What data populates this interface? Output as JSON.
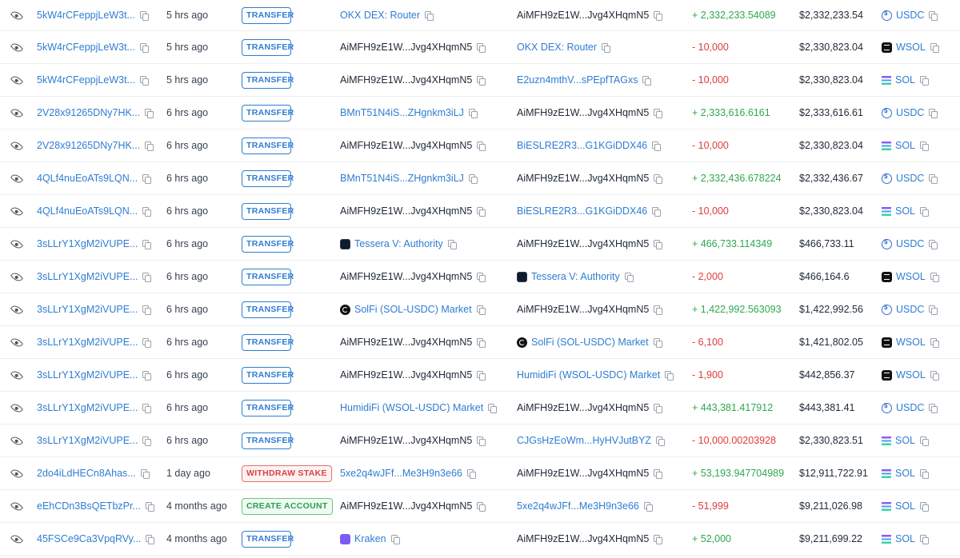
{
  "colors": {
    "link": "#2f7dd1",
    "positive": "#2fa84f",
    "negative": "#e03b3b",
    "transfer_badge": "#2f7dd1",
    "withdraw_badge": "#d64545",
    "create_badge": "#2e9e4f"
  },
  "rows": [
    {
      "sig": "5kW4rCFeppjLeW3t...",
      "time": "5 hrs ago",
      "type": "TRANSFER",
      "type_kind": "transfer",
      "from": "OKX DEX: Router",
      "from_link": true,
      "from_icon": "",
      "to": "AiMFH9zE1W...Jvg4XHqmN5",
      "to_link": false,
      "to_icon": "",
      "amount": "+ 2,332,233.54089",
      "sign": "pos",
      "value": "$2,332,233.54",
      "token": "USDC",
      "token_icon": "usdc-icon"
    },
    {
      "sig": "5kW4rCFeppjLeW3t...",
      "time": "5 hrs ago",
      "type": "TRANSFER",
      "type_kind": "transfer",
      "from": "AiMFH9zE1W...Jvg4XHqmN5",
      "from_link": false,
      "from_icon": "",
      "to": "OKX DEX: Router",
      "to_link": true,
      "to_icon": "",
      "amount": "- 10,000",
      "sign": "neg",
      "value": "$2,330,823.04",
      "token": "WSOL",
      "token_icon": "wsol-icon"
    },
    {
      "sig": "5kW4rCFeppjLeW3t...",
      "time": "5 hrs ago",
      "type": "TRANSFER",
      "type_kind": "transfer",
      "from": "AiMFH9zE1W...Jvg4XHqmN5",
      "from_link": false,
      "from_icon": "",
      "to": "E2uzn4mthV...sPEpfTAGxs",
      "to_link": true,
      "to_icon": "",
      "amount": "- 10,000",
      "sign": "neg",
      "value": "$2,330,823.04",
      "token": "SOL",
      "token_icon": "sol-icon"
    },
    {
      "sig": "2V28x91265DNy7HK...",
      "time": "6 hrs ago",
      "type": "TRANSFER",
      "type_kind": "transfer",
      "from": "BMnT51N4iS...ZHgnkm3iLJ",
      "from_link": true,
      "from_icon": "",
      "to": "AiMFH9zE1W...Jvg4XHqmN5",
      "to_link": false,
      "to_icon": "",
      "amount": "+ 2,333,616.6161",
      "sign": "pos",
      "value": "$2,333,616.61",
      "token": "USDC",
      "token_icon": "usdc-icon"
    },
    {
      "sig": "2V28x91265DNy7HK...",
      "time": "6 hrs ago",
      "type": "TRANSFER",
      "type_kind": "transfer",
      "from": "AiMFH9zE1W...Jvg4XHqmN5",
      "from_link": false,
      "from_icon": "",
      "to": "BiESLRE2R3...G1KGiDDX46",
      "to_link": true,
      "to_icon": "",
      "amount": "- 10,000",
      "sign": "neg",
      "value": "$2,330,823.04",
      "token": "SOL",
      "token_icon": "sol-icon"
    },
    {
      "sig": "4QLf4nuEoATs9LQN...",
      "time": "6 hrs ago",
      "type": "TRANSFER",
      "type_kind": "transfer",
      "from": "BMnT51N4iS...ZHgnkm3iLJ",
      "from_link": true,
      "from_icon": "",
      "to": "AiMFH9zE1W...Jvg4XHqmN5",
      "to_link": false,
      "to_icon": "",
      "amount": "+ 2,332,436.678224",
      "sign": "pos",
      "value": "$2,332,436.67",
      "token": "USDC",
      "token_icon": "usdc-icon"
    },
    {
      "sig": "4QLf4nuEoATs9LQN...",
      "time": "6 hrs ago",
      "type": "TRANSFER",
      "type_kind": "transfer",
      "from": "AiMFH9zE1W...Jvg4XHqmN5",
      "from_link": false,
      "from_icon": "",
      "to": "BiESLRE2R3...G1KGiDDX46",
      "to_link": true,
      "to_icon": "",
      "amount": "- 10,000",
      "sign": "neg",
      "value": "$2,330,823.04",
      "token": "SOL",
      "token_icon": "sol-icon"
    },
    {
      "sig": "3sLLrY1XgM2iVUPE...",
      "time": "6 hrs ago",
      "type": "TRANSFER",
      "type_kind": "transfer",
      "from": "Tessera V: Authority",
      "from_link": true,
      "from_icon": "tessera",
      "to": "AiMFH9zE1W...Jvg4XHqmN5",
      "to_link": false,
      "to_icon": "",
      "amount": "+ 466,733.114349",
      "sign": "pos",
      "value": "$466,733.11",
      "token": "USDC",
      "token_icon": "usdc-icon"
    },
    {
      "sig": "3sLLrY1XgM2iVUPE...",
      "time": "6 hrs ago",
      "type": "TRANSFER",
      "type_kind": "transfer",
      "from": "AiMFH9zE1W...Jvg4XHqmN5",
      "from_link": false,
      "from_icon": "",
      "to": "Tessera V: Authority",
      "to_link": true,
      "to_icon": "tessera",
      "amount": "- 2,000",
      "sign": "neg",
      "value": "$466,164.6",
      "token": "WSOL",
      "token_icon": "wsol-icon"
    },
    {
      "sig": "3sLLrY1XgM2iVUPE...",
      "time": "6 hrs ago",
      "type": "TRANSFER",
      "type_kind": "transfer",
      "from": "SolFi (SOL-USDC) Market",
      "from_link": true,
      "from_icon": "solfi",
      "to": "AiMFH9zE1W...Jvg4XHqmN5",
      "to_link": false,
      "to_icon": "",
      "amount": "+ 1,422,992.563093",
      "sign": "pos",
      "value": "$1,422,992.56",
      "token": "USDC",
      "token_icon": "usdc-icon"
    },
    {
      "sig": "3sLLrY1XgM2iVUPE...",
      "time": "6 hrs ago",
      "type": "TRANSFER",
      "type_kind": "transfer",
      "from": "AiMFH9zE1W...Jvg4XHqmN5",
      "from_link": false,
      "from_icon": "",
      "to": "SolFi (SOL-USDC) Market",
      "to_link": true,
      "to_icon": "solfi",
      "amount": "- 6,100",
      "sign": "neg",
      "value": "$1,421,802.05",
      "token": "WSOL",
      "token_icon": "wsol-icon"
    },
    {
      "sig": "3sLLrY1XgM2iVUPE...",
      "time": "6 hrs ago",
      "type": "TRANSFER",
      "type_kind": "transfer",
      "from": "AiMFH9zE1W...Jvg4XHqmN5",
      "from_link": false,
      "from_icon": "",
      "to": "HumidiFi (WSOL-USDC) Market",
      "to_link": true,
      "to_icon": "",
      "amount": "- 1,900",
      "sign": "neg",
      "value": "$442,856.37",
      "token": "WSOL",
      "token_icon": "wsol-icon"
    },
    {
      "sig": "3sLLrY1XgM2iVUPE...",
      "time": "6 hrs ago",
      "type": "TRANSFER",
      "type_kind": "transfer",
      "from": "HumidiFi (WSOL-USDC) Market",
      "from_link": true,
      "from_icon": "",
      "to": "AiMFH9zE1W...Jvg4XHqmN5",
      "to_link": false,
      "to_icon": "",
      "amount": "+ 443,381.417912",
      "sign": "pos",
      "value": "$443,381.41",
      "token": "USDC",
      "token_icon": "usdc-icon"
    },
    {
      "sig": "3sLLrY1XgM2iVUPE...",
      "time": "6 hrs ago",
      "type": "TRANSFER",
      "type_kind": "transfer",
      "from": "AiMFH9zE1W...Jvg4XHqmN5",
      "from_link": false,
      "from_icon": "",
      "to": "CJGsHzEoWm...HyHVJutBYZ",
      "to_link": true,
      "to_icon": "",
      "amount": "- 10,000.00203928",
      "sign": "neg",
      "value": "$2,330,823.51",
      "token": "SOL",
      "token_icon": "sol-icon"
    },
    {
      "sig": "2do4iLdHECn8Ahas...",
      "time": "1 day ago",
      "type": "WITHDRAW STAKE",
      "type_kind": "withdraw",
      "from": "5xe2q4wJFf...Me3H9n3e66",
      "from_link": true,
      "from_icon": "",
      "to": "AiMFH9zE1W...Jvg4XHqmN5",
      "to_link": false,
      "to_icon": "",
      "amount": "+ 53,193.947704989",
      "sign": "pos",
      "value": "$12,911,722.91",
      "token": "SOL",
      "token_icon": "sol-icon"
    },
    {
      "sig": "eEhCDn3BsQETbzPr...",
      "time": "4 months ago",
      "type": "CREATE ACCOUNT",
      "type_kind": "create",
      "from": "AiMFH9zE1W...Jvg4XHqmN5",
      "from_link": false,
      "from_icon": "",
      "to": "5xe2q4wJFf...Me3H9n3e66",
      "to_link": true,
      "to_icon": "",
      "amount": "- 51,999",
      "sign": "neg",
      "value": "$9,211,026.98",
      "token": "SOL",
      "token_icon": "sol-icon"
    },
    {
      "sig": "45FSCe9Ca3VpqRVy...",
      "time": "4 months ago",
      "type": "TRANSFER",
      "type_kind": "transfer",
      "from": "Kraken",
      "from_link": true,
      "from_icon": "kraken",
      "to": "AiMFH9zE1W...Jvg4XHqmN5",
      "to_link": false,
      "to_icon": "",
      "amount": "+ 52,000",
      "sign": "pos",
      "value": "$9,211,699.22",
      "token": "SOL",
      "token_icon": "sol-icon"
    }
  ]
}
